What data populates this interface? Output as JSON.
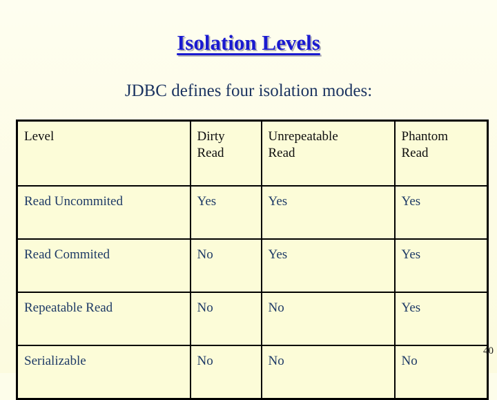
{
  "slide": {
    "title": "Isolation Levels",
    "subtitle": "JDBC defines four isolation modes:",
    "page_number": "40",
    "colors": {
      "background": "#fdfdea",
      "title": "#1a1ad0",
      "subtitle": "#1b3360",
      "header_text": "#0d0d0d",
      "body_text": "#1e3a66",
      "table_fill": "#fcfcd8",
      "border": "#000000"
    }
  },
  "table": {
    "headers": [
      {
        "line1": "Level",
        "line2": ""
      },
      {
        "line1": "Dirty",
        "line2": "Read"
      },
      {
        "line1": "Unrepeatable",
        "line2": "Read"
      },
      {
        "line1": "Phantom",
        "line2": "Read"
      }
    ],
    "rows": [
      {
        "level": "Read Uncommited",
        "dirty_read": "Yes",
        "unrepeatable_read": "Yes",
        "phantom_read": "Yes"
      },
      {
        "level": "Read Commited",
        "dirty_read": "No",
        "unrepeatable_read": "Yes",
        "phantom_read": "Yes"
      },
      {
        "level": "Repeatable Read",
        "dirty_read": "No",
        "unrepeatable_read": "No",
        "phantom_read": "Yes"
      },
      {
        "level": "Serializable",
        "dirty_read": "No",
        "unrepeatable_read": "No",
        "phantom_read": "No"
      }
    ]
  }
}
